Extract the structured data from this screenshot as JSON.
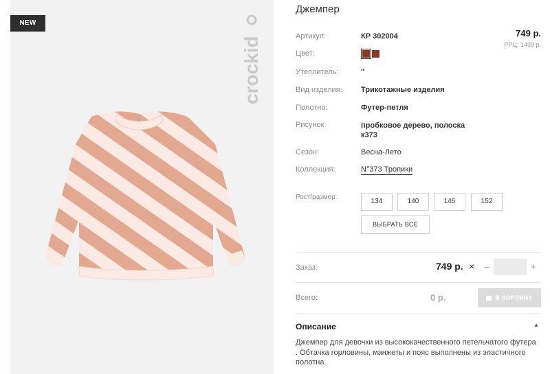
{
  "product": {
    "badge": "NEW",
    "brand": "crockid",
    "title": "Джемпер",
    "price": "749 р.",
    "rrp": "РРЦ: 1499 р."
  },
  "specs": {
    "article": {
      "label": "Артикул:",
      "value": "КР 302004"
    },
    "color": {
      "label": "Цвет:",
      "swatches": [
        "#8a3a22",
        "#8a3a22"
      ]
    },
    "insulation": {
      "label": "Утеплитель:",
      "value": "\""
    },
    "type": {
      "label": "Вид изделия:",
      "value": "Трикотажные изделия"
    },
    "fabric": {
      "label": "Полотно:",
      "value": "Футер-петля"
    },
    "pattern": {
      "label": "Рисунок:",
      "value": "пробковое дерево, полоска к373"
    },
    "season": {
      "label": "Сезон:",
      "value": "Весна-Лето"
    },
    "collection": {
      "label": "Коллекция:",
      "value": "N°373 Тропики"
    }
  },
  "sizes": {
    "label": "Рост/размер:",
    "options": [
      "134",
      "140",
      "146",
      "152"
    ],
    "select_all": "ВЫБРАТЬ ВСЕ"
  },
  "order": {
    "label": "Заказ:",
    "price": "749 р.",
    "times": "×",
    "minus": "–",
    "plus": "+",
    "quantity": ""
  },
  "total": {
    "label": "Всего:",
    "value": "0 р.",
    "cart_button": "В КОРЗИНУ"
  },
  "description": {
    "heading": "Описание",
    "text": "Джемпер для девочки из высококачественного петельчатого футера . Обтачка горловины, манжеты и пояс выполнены из эластичного полотна."
  },
  "colors": {
    "stripe": "#e2a890",
    "fabric_light": "#fbe9e3",
    "swatch": "#8a3a22"
  }
}
